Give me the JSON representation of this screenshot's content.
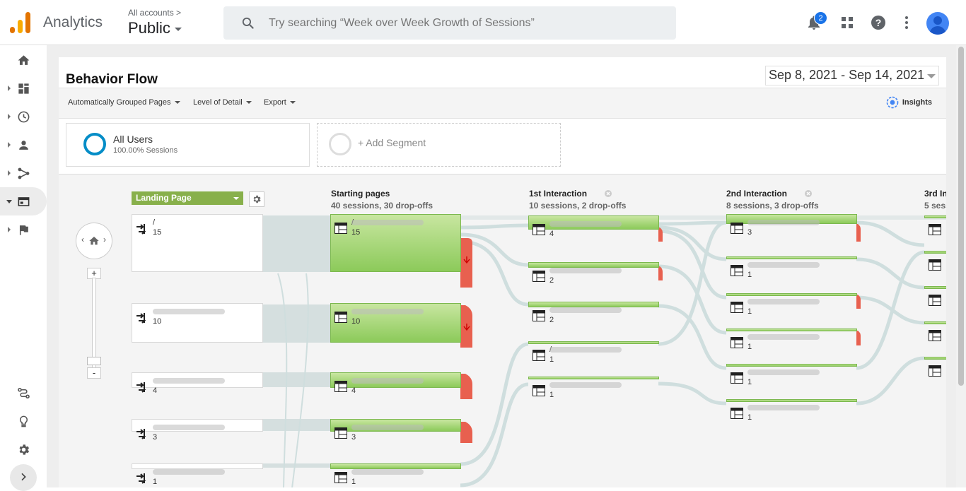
{
  "header": {
    "brand": "Analytics",
    "account_crumb": "All accounts",
    "property": "Public",
    "search_placeholder": "Try searching “Week over Week Growth of Sessions”",
    "notification_count": "2"
  },
  "report": {
    "title": "Behavior Flow",
    "date_range": "Sep 8, 2021 - Sep 14, 2021",
    "toolbar": [
      "Automatically Grouped Pages",
      "Level of Detail",
      "Export"
    ],
    "insights_label": "Insights"
  },
  "segments": [
    {
      "name": "All Users",
      "detail": "100.00% Sessions"
    },
    {
      "name": "+ Add Segment"
    }
  ],
  "flow": {
    "dimension_selector": "Landing Page",
    "columns": [
      {
        "title": "Starting pages",
        "sub": "40 sessions, 30 drop-offs"
      },
      {
        "title": "1st Interaction",
        "sub": "10 sessions, 2 drop-offs"
      },
      {
        "title": "2nd Interaction",
        "sub": "8 sessions, 3 drop-offs"
      },
      {
        "title": "3rd In",
        "sub": "5 sess"
      }
    ],
    "landing_nodes": [
      {
        "label": "/",
        "sessions": "15"
      },
      {
        "label": "",
        "sessions": "10"
      },
      {
        "label": "",
        "sessions": "4"
      },
      {
        "label": "",
        "sessions": "3"
      },
      {
        "label": "",
        "sessions": "1"
      }
    ],
    "starting_nodes": [
      {
        "label": "/",
        "sessions": "15"
      },
      {
        "label": "",
        "sessions": "10"
      },
      {
        "label": "",
        "sessions": "4"
      },
      {
        "label": "",
        "sessions": "3"
      },
      {
        "label": "",
        "sessions": "1"
      }
    ],
    "interaction1_nodes": [
      {
        "label": "",
        "sessions": "4"
      },
      {
        "label": "",
        "sessions": "2"
      },
      {
        "label": "",
        "sessions": "2"
      },
      {
        "label": "/",
        "sessions": "1"
      },
      {
        "label": "",
        "sessions": "1"
      }
    ],
    "interaction2_nodes": [
      {
        "label": "",
        "sessions": "3"
      },
      {
        "label": "",
        "sessions": "1"
      },
      {
        "label": "",
        "sessions": "1"
      },
      {
        "label": "",
        "sessions": "1"
      },
      {
        "label": "",
        "sessions": "1"
      },
      {
        "label": "",
        "sessions": "1"
      }
    ]
  },
  "colors": {
    "accent": "#1a73e8",
    "node_green": "#8cca5a",
    "dropoff": "#e8604f",
    "segment_ring": "#058dc7"
  }
}
